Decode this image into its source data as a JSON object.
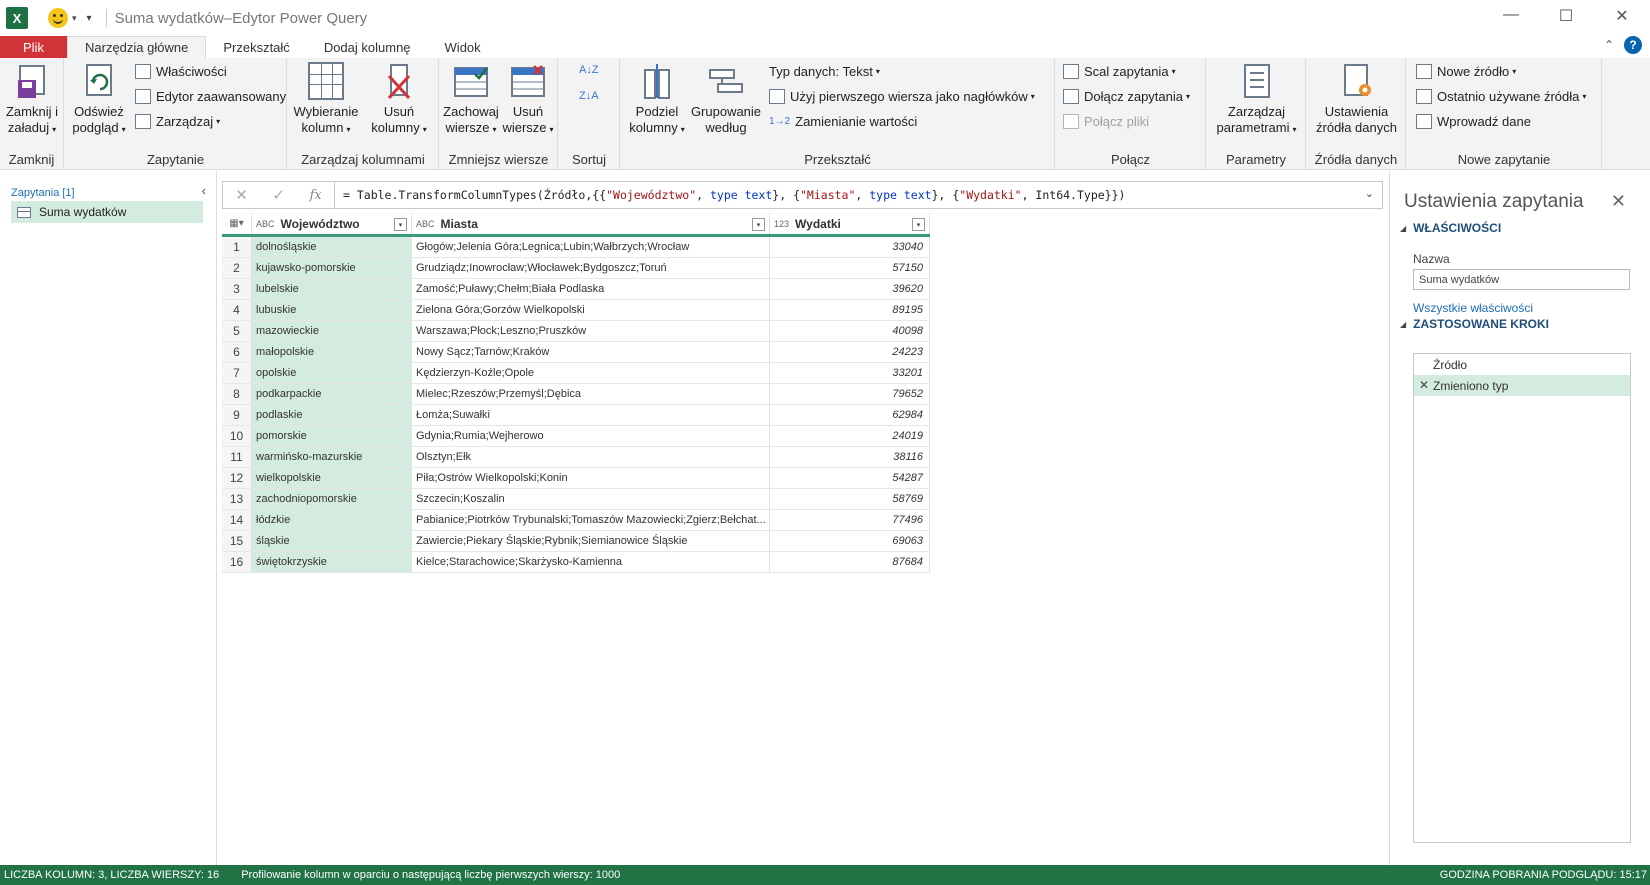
{
  "titlebar": {
    "logo_text": "X",
    "title": "Suma wydatków–Edytor Power Query",
    "minimize": "—",
    "maximize": "☐",
    "close": "✕"
  },
  "tabs": {
    "items": [
      "Plik",
      "Narzędzia główne",
      "Przekształć",
      "Dodaj kolumnę",
      "Widok"
    ],
    "active": "Narzędzia główne",
    "help": "?"
  },
  "ribbon": {
    "groups": {
      "zamknij": {
        "label": "Zamknij",
        "close_load_line1": "Zamknij i",
        "close_load_line2": "załaduj"
      },
      "zapytanie": {
        "label": "Zapytanie",
        "refresh_line1": "Odśwież",
        "refresh_line2": "podgląd",
        "properties": "Właściwości",
        "advanced_editor": "Edytor zaawansowany",
        "manage": "Zarządzaj"
      },
      "kolumny": {
        "label": "Zarządzaj kolumnami",
        "choose_line1": "Wybieranie",
        "choose_line2": "kolumn",
        "remove_line1": "Usuń",
        "remove_line2": "kolumny"
      },
      "wiersze": {
        "label": "Zmniejsz wiersze",
        "keep_line1": "Zachowaj",
        "keep_line2": "wiersze",
        "remove_line1": "Usuń",
        "remove_line2": "wiersze"
      },
      "sortuj": {
        "label": "Sortuj"
      },
      "przeksztalc": {
        "label": "Przekształć",
        "split_line1": "Podziel",
        "split_line2": "kolumny",
        "group_line1": "Grupowanie",
        "group_line2": "według",
        "data_type": "Typ danych: Tekst",
        "first_row_headers": "Użyj pierwszego wiersza jako nagłówków",
        "replace_values": "Zamienianie wartości"
      },
      "polacz": {
        "label": "Połącz",
        "merge": "Scal zapytania",
        "append": "Dołącz zapytania",
        "combine_files": "Połącz pliki"
      },
      "parametry": {
        "label": "Parametry",
        "manage_line1": "Zarządzaj",
        "manage_line2": "parametrami"
      },
      "zrodla": {
        "label": "Źródła danych",
        "settings_line1": "Ustawienia",
        "settings_line2": "źródła danych"
      },
      "nowe": {
        "label": "Nowe zapytanie",
        "new_source": "Nowe źródło",
        "recent_sources": "Ostatnio używane źródła",
        "enter_data": "Wprowadź dane"
      }
    }
  },
  "queries_pane": {
    "header": "Zapytania [1]",
    "items": [
      "Suma wydatków"
    ]
  },
  "formula_bar": {
    "cancel": "✕",
    "confirm": "✓",
    "fx": "fx",
    "prefix": "= Table.TransformColumnTypes(Źródło,{{",
    "s1": "\"Województwo\"",
    "sep1": ", ",
    "k1": "type text",
    "mid1": "}, {",
    "s2": "\"Miasta\"",
    "sep2": ", ",
    "k2": "type text",
    "mid2": "}, {",
    "s3": "\"Wydatki\"",
    "suffix": ", Int64.Type}})"
  },
  "table": {
    "columns": [
      {
        "name": "Województwo",
        "type_icon": "ABC"
      },
      {
        "name": "Miasta",
        "type_icon": "ABC"
      },
      {
        "name": "Wydatki",
        "type_icon": "123"
      }
    ],
    "rows": [
      [
        "1",
        "dolnośląskie",
        "Głogów;Jelenia Góra;Legnica;Lubin;Wałbrzych;Wrocław",
        "33040"
      ],
      [
        "2",
        "kujawsko-pomorskie",
        "Grudziądz;Inowrocław;Włocławek;Bydgoszcz;Toruń",
        "57150"
      ],
      [
        "3",
        "lubelskie",
        "Zamość;Puławy;Chełm;Biała Podlaska",
        "39620"
      ],
      [
        "4",
        "lubuskie",
        "Zielona Góra;Gorzów Wielkopolski",
        "89195"
      ],
      [
        "5",
        "mazowieckie",
        "Warszawa;Płock;Leszno;Pruszków",
        "40098"
      ],
      [
        "6",
        "małopolskie",
        "Nowy Sącz;Tarnów;Kraków",
        "24223"
      ],
      [
        "7",
        "opolskie",
        "Kędzierzyn-Koźle;Opole",
        "33201"
      ],
      [
        "8",
        "podkarpackie",
        "Mielec;Rzeszów;Przemyśl;Dębica",
        "79652"
      ],
      [
        "9",
        "podlaskie",
        "Łomża;Suwałki",
        "62984"
      ],
      [
        "10",
        "pomorskie",
        "Gdynia;Rumia;Wejherowo",
        "24019"
      ],
      [
        "11",
        "warmińsko-mazurskie",
        "Olsztyn;Ełk",
        "38116"
      ],
      [
        "12",
        "wielkopolskie",
        "Piła;Ostrów Wielkopolski;Konin",
        "54287"
      ],
      [
        "13",
        "zachodniopomorskie",
        "Szczecin;Koszalin",
        "58769"
      ],
      [
        "14",
        "łódzkie",
        "Pabianice;Piotrków Trybunalski;Tomaszów Mazowiecki;Zgierz;Bełchat...",
        "77496"
      ],
      [
        "15",
        "śląskie",
        "Zawiercie;Piekary Śląskie;Rybnik;Siemianowice Śląskie",
        "69063"
      ],
      [
        "16",
        "świętokrzyskie",
        "Kielce;Starachowice;Skarżysko-Kamienna",
        "87684"
      ]
    ]
  },
  "settings_pane": {
    "title": "Ustawienia zapytania",
    "properties_header": "WŁAŚCIWOŚCI",
    "name_label": "Nazwa",
    "name_value": "Suma wydatków",
    "all_properties": "Wszystkie właściwości",
    "steps_header": "ZASTOSOWANE KROKI",
    "steps": [
      "Źródło",
      "Zmieniono typ"
    ],
    "selected_step": "Zmieniono typ"
  },
  "statusbar": {
    "counts": "LICZBA KOLUMN: 3, LICZBA WIERSZY: 16",
    "profiling": "Profilowanie kolumn w oparciu o następującą liczbę pierwszych wierszy: 1000",
    "download_time": "GODZINA POBRANIA PODGLĄDU: 15:17"
  }
}
